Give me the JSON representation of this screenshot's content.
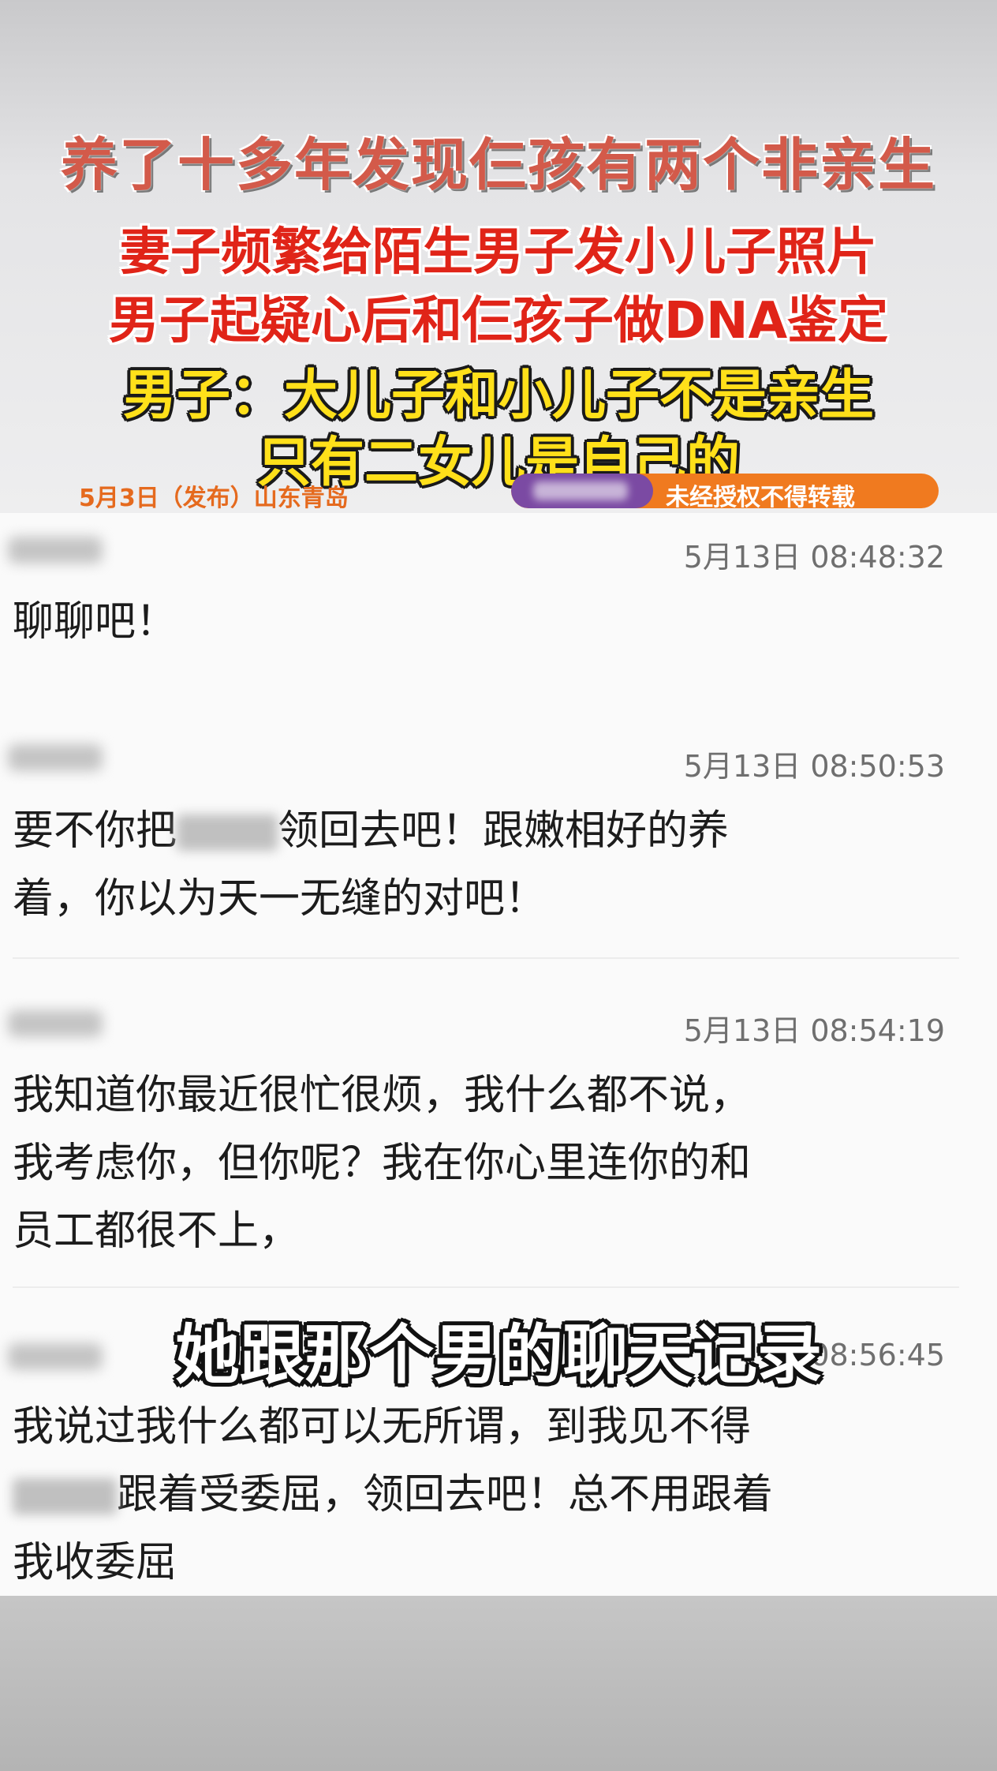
{
  "header": {
    "line1": "养了十多年发现仨孩有两个非亲生",
    "line2": "妻子频繁给陌生男子发小儿子照片",
    "line3": "男子起疑心后和仨孩子做DNA鉴定",
    "line4": "男子：大儿子和小儿子不是亲生",
    "line5": "只有二女儿是自己的",
    "date_location": "5月3日（发布）山东青岛",
    "copyright_notice": "未经授权不得转载"
  },
  "messages": [
    {
      "timestamp": "5月13日 08:48:32",
      "lines": [
        "聊聊吧！"
      ]
    },
    {
      "timestamp": "5月13日 08:50:53",
      "line1_before": "要不你把",
      "line1_after": "领回去吧！跟嫩相好的养",
      "line2": "着，你以为天一无缝的对吧！"
    },
    {
      "timestamp": "5月13日 08:54:19",
      "lines": [
        "我知道你最近很忙很烦，我什么都不说，",
        "我考虑你，但你呢？我在你心里连你的和",
        "员工都很不上，"
      ]
    },
    {
      "timestamp_partial": "08:56:45",
      "line1": "我说过我什么都可以无所谓，到我见不得",
      "line2_after": "跟着受委屈，领回去吧！总不用跟着",
      "line3": "我收委屈"
    }
  ],
  "subtitle": "她跟那个男的聊天记录",
  "colors": {
    "headline_red": "#e02418",
    "headline_yellow": "#ffe01a",
    "badge_orange": "#f07a1f",
    "badge_purple": "#7b4aa3"
  }
}
